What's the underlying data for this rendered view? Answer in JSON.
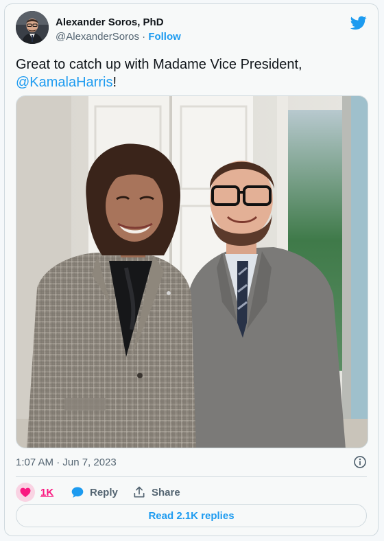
{
  "author": {
    "name": "Alexander Soros, PhD",
    "handle": "@AlexanderSoros",
    "separator": " · ",
    "follow_label": "Follow"
  },
  "tweet": {
    "text_before": "Great to catch up with Madame Vice President, ",
    "mention": "@KamalaHarris",
    "text_after": "!",
    "timestamp": "1:07 AM · Jun 7, 2023"
  },
  "actions": {
    "like_count": "1K",
    "reply_label": "Reply",
    "share_label": "Share",
    "read_replies_label": "Read 2.1K replies"
  },
  "icons": {
    "brand": "twitter-bird-icon",
    "info": "info-icon",
    "like": "heart-icon",
    "reply": "reply-bubble-icon",
    "share": "share-icon"
  },
  "colors": {
    "accent": "#1d9bf0",
    "like": "#f91880",
    "text": "#0f1419",
    "muted": "#536471",
    "border": "#cfd9de"
  }
}
